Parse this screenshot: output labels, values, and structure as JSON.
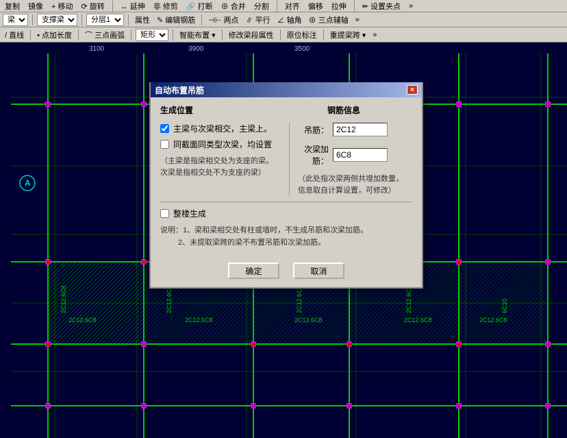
{
  "toolbar": {
    "row1": {
      "items": [
        "复制",
        "镜像",
        "移动",
        "旋转",
        "延伸",
        "修剪",
        "打断",
        "合并",
        "分割",
        "对齐",
        "偏移",
        "拉伸",
        "设置夹点"
      ]
    },
    "row2": {
      "beam_label": "梁",
      "beam_type": "支撑梁",
      "layer": "分层1",
      "items": [
        "属性",
        "编辑钢筋"
      ],
      "extra": [
        "两点",
        "平行",
        "轴角",
        "三点辅轴"
      ]
    },
    "row3": {
      "items": [
        "直线",
        "点加长度",
        "三点画弧"
      ],
      "shape": "矩形",
      "items2": [
        "智能布置",
        "修改梁段属性",
        "原位标注",
        "重提梁跨"
      ]
    }
  },
  "ruler": {
    "marks": [
      "3100",
      "3900",
      "3500"
    ]
  },
  "dialog": {
    "title": "自动布置吊筋",
    "close_btn": "×",
    "section_left": "生成位置",
    "section_right": "钢筋信息",
    "checkbox1_label": "主梁与次梁相交，主梁上。",
    "checkbox1_checked": true,
    "checkbox2_label": "同截面同类型次梁，均设置",
    "checkbox2_checked": false,
    "note1": "（主梁是指梁相交处为支座的梁。\n次梁是指相交处不为支座的梁）",
    "dongji_label": "吊筋：",
    "dongji_value": "2C12",
    "cijia_label": "次梁加筋：",
    "cijia_value": "6C8",
    "rebar_note": "（此处指次梁两侧共增加数量，\n信息取自计算设置，可修改）",
    "wholebuild_label": "整楼生成",
    "wholebuild_checked": false,
    "note_block": "说明：1、梁和梁相交处有柱或墙时，不生成吊筋和次梁加筋。\n      2、未提取梁跨的梁不布置吊筋和次梁加筋。",
    "confirm_btn": "确定",
    "cancel_btn": "取消"
  },
  "cad": {
    "grid_labels": [
      "3100",
      "3900",
      "3500"
    ],
    "beam_labels": [
      "2C12,6C8",
      "2C12,6C8",
      "2C12,6C8"
    ],
    "circle_label": "A"
  }
}
